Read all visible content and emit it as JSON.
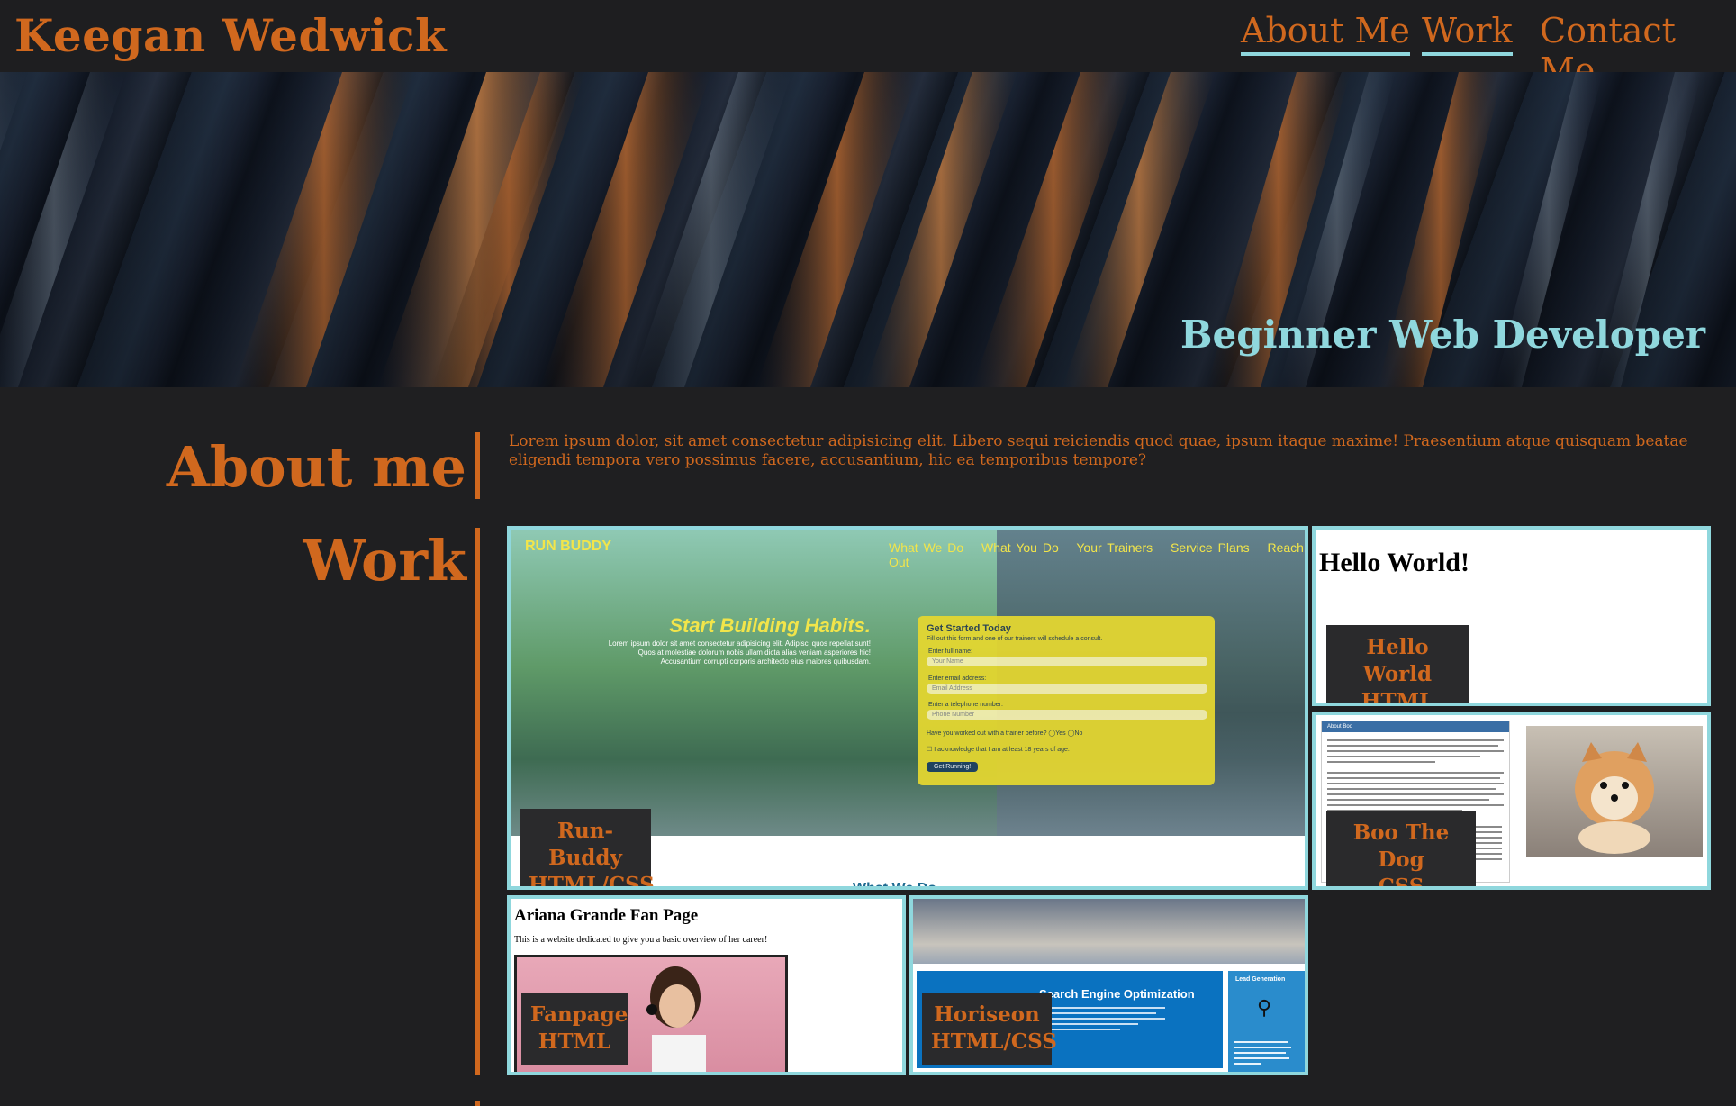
{
  "header": {
    "site_title": "Keegan Wedwick",
    "nav": [
      {
        "label": "About Me"
      },
      {
        "label": "Work"
      },
      {
        "label": "Contact Me"
      }
    ]
  },
  "hero": {
    "subtitle": "Beginner Web Developer"
  },
  "about": {
    "heading": "About me",
    "text": "Lorem ipsum dolor, sit amet consectetur adipisicing elit. Libero sequi reiciendis quod quae, ipsum itaque maxime! Praesentium atque quisquam beatae eligendi tempora vero possimus facere, accusantium, hic ea temporibus tempore?"
  },
  "work": {
    "heading": "Work",
    "projects": [
      {
        "title": "Run-Buddy",
        "tech": "HTML/CSS",
        "preview": {
          "brand": "RUN BUDDY",
          "nav": [
            "What We Do",
            "What You Do",
            "Your Trainers",
            "Service Plans",
            "Reach Out"
          ],
          "headline": "Start Building Habits.",
          "blurb": "Lorem ipsum dolor sit amet consectetur adipisicing elit. Adipisci quos repellat sunt! Quos at molestiae dolorum nobis ullam dicta alias veniam asperiores hic! Accusantium corrupti corporis architecto eius maiores quibusdam.",
          "form_title": "Get Started Today",
          "form_sub": "Fill out this form and one of our trainers will schedule a consult.",
          "fields": [
            {
              "label": "Enter full name:",
              "placeholder": "Your Name"
            },
            {
              "label": "Enter email address:",
              "placeholder": "Email Address"
            },
            {
              "label": "Enter a telephone number:",
              "placeholder": "Phone Number"
            }
          ],
          "question": "Have you worked out with a trainer before?",
          "options": [
            "Yes",
            "No"
          ],
          "checkbox": "I acknowledge that I am at least 18 years of age.",
          "button": "Get Running!",
          "footer_peek": "What We Do"
        }
      },
      {
        "title": "Hello World",
        "tech": "HTML",
        "preview": {
          "heading": "Hello World!"
        }
      },
      {
        "title": "Boo The Dog",
        "tech": "CSS",
        "preview": {
          "bar": "About Boo"
        }
      },
      {
        "title": "Fanpage",
        "tech": "HTML",
        "preview": {
          "heading": "Ariana Grande Fan Page",
          "sub": "This is a website dedicated to give you a basic overview of her career!"
        }
      },
      {
        "title": "Horiseon",
        "tech": "HTML/CSS",
        "preview": {
          "seo": "Search Engine Optimization",
          "lead": "Lead Generation"
        }
      }
    ]
  },
  "colors": {
    "accent_orange": "#d0681e",
    "accent_teal": "#8fd7dd",
    "background": "#1f1f21"
  }
}
